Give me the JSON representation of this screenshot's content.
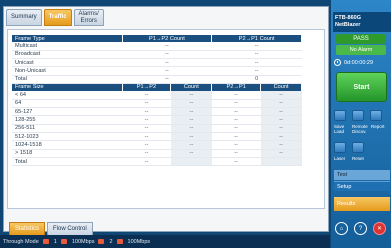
{
  "tabs": {
    "summary": "Summary",
    "traffic": "Traffic",
    "alarms": "Alarms/ Errors"
  },
  "frame_type_table": {
    "headers": [
      "Frame Type",
      "P1→P2 Count",
      "P2→P1 Count"
    ],
    "rows": [
      {
        "label": "Multicast",
        "p1p2": "--",
        "p2p1": "--"
      },
      {
        "label": "Broadcast",
        "p1p2": "--",
        "p2p1": "--"
      },
      {
        "label": "Unicast",
        "p1p2": "--",
        "p2p1": "--"
      },
      {
        "label": "Non-Unicast",
        "p1p2": "--",
        "p2p1": "--"
      },
      {
        "label": "Total",
        "p1p2": "--",
        "p2p1": "0"
      }
    ]
  },
  "frame_size_table": {
    "headers": [
      "Frame Size",
      "P1→P2",
      "Count",
      "P2→P1",
      "Count"
    ],
    "rows": [
      {
        "label": "< 64",
        "a": "--",
        "b": "--",
        "c": "--",
        "d": "--"
      },
      {
        "label": "64",
        "a": "--",
        "b": "--",
        "c": "--",
        "d": "--"
      },
      {
        "label": "65-127",
        "a": "--",
        "b": "--",
        "c": "--",
        "d": "--"
      },
      {
        "label": "128-255",
        "a": "--",
        "b": "--",
        "c": "--",
        "d": "--"
      },
      {
        "label": "256-511",
        "a": "--",
        "b": "--",
        "c": "--",
        "d": "--"
      },
      {
        "label": "512-1023",
        "a": "--",
        "b": "--",
        "c": "--",
        "d": "--"
      },
      {
        "label": "1024-1518",
        "a": "--",
        "b": "--",
        "c": "--",
        "d": "--"
      },
      {
        "label": "> 1518",
        "a": "--",
        "b": "--",
        "c": "--",
        "d": "--"
      },
      {
        "label": "Total",
        "a": "--",
        "b": "",
        "c": "--",
        "d": ""
      }
    ]
  },
  "bottom_tabs": {
    "statistics": "Statistics",
    "flow_control": "Flow Control"
  },
  "status_bar": {
    "mode": "Through Mode",
    "port1": "1",
    "speed1": "100Mbps",
    "port2": "2",
    "speed2": "100Mbps"
  },
  "right_panel": {
    "device_line1": "FTB-860G",
    "device_line2": "NetBlazer",
    "pass": "PASS",
    "no_alarm": "No Alarm",
    "timer": "0d:00:00:29",
    "start": "Start",
    "buttons": [
      "Save Load",
      "Remote Discov.",
      "Report",
      "Laser",
      "Reset"
    ],
    "menu_test": "Test",
    "menu_setup": "Setup",
    "menu_results": "Results"
  }
}
